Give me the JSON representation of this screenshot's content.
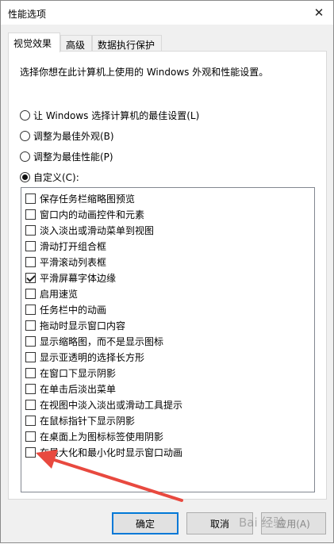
{
  "window": {
    "title": "性能选项",
    "close_glyph": "✕"
  },
  "tabs": [
    {
      "label": "视觉效果",
      "active": true
    },
    {
      "label": "高级",
      "active": false
    },
    {
      "label": "数据执行保护",
      "active": false
    }
  ],
  "description": "选择你想在此计算机上使用的 Windows 外观和性能设置。",
  "radios": [
    {
      "label": "让 Windows 选择计算机的最佳设置(L)",
      "checked": false
    },
    {
      "label": "调整为最佳外观(B)",
      "checked": false
    },
    {
      "label": "调整为最佳性能(P)",
      "checked": false
    },
    {
      "label": "自定义(C):",
      "checked": true
    }
  ],
  "options": [
    {
      "label": "保存任务栏缩略图预览",
      "checked": false
    },
    {
      "label": "窗口内的动画控件和元素",
      "checked": false
    },
    {
      "label": "淡入淡出或滑动菜单到视图",
      "checked": false
    },
    {
      "label": "滑动打开组合框",
      "checked": false
    },
    {
      "label": "平滑滚动列表框",
      "checked": false
    },
    {
      "label": "平滑屏幕字体边缘",
      "checked": true
    },
    {
      "label": "启用速览",
      "checked": false
    },
    {
      "label": "任务栏中的动画",
      "checked": false
    },
    {
      "label": "拖动时显示窗口内容",
      "checked": false
    },
    {
      "label": "显示缩略图，而不是显示图标",
      "checked": false
    },
    {
      "label": "显示亚透明的选择长方形",
      "checked": false
    },
    {
      "label": "在窗口下显示阴影",
      "checked": false
    },
    {
      "label": "在单击后淡出菜单",
      "checked": false
    },
    {
      "label": "在视图中淡入淡出或滑动工具提示",
      "checked": false
    },
    {
      "label": "在鼠标指针下显示阴影",
      "checked": false
    },
    {
      "label": "在桌面上为图标标签使用阴影",
      "checked": false
    },
    {
      "label": "在最大化和最小化时显示窗口动画",
      "checked": false
    }
  ],
  "buttons": {
    "ok": "确定",
    "cancel": "取消",
    "apply": "应用(A)"
  },
  "watermark": "Bai 经验",
  "colors": {
    "arrow": "#e8493f",
    "default_button_border": "#0078d7"
  }
}
